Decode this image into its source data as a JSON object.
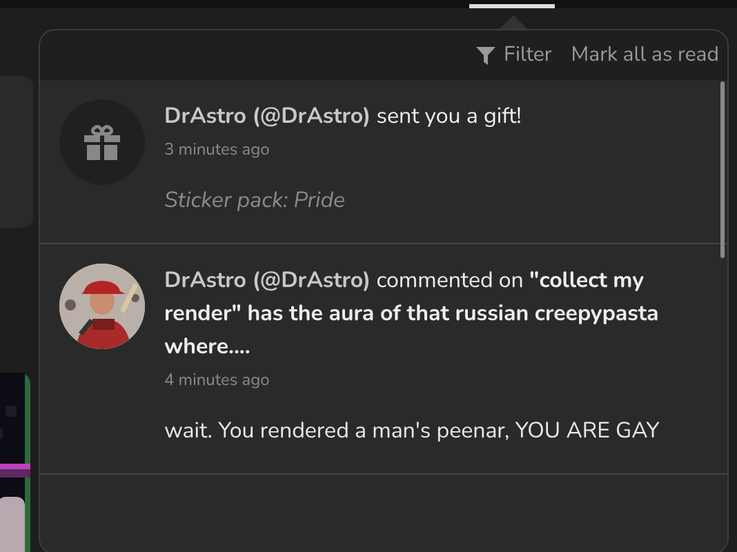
{
  "header": {
    "filter": "Filter",
    "mark_all": "Mark all as read"
  },
  "notifications": [
    {
      "kind": "gift",
      "text": "**DrAstro (@DrAstro)** sent you a gift!",
      "time": "3 minutes ago",
      "body": "Sticker pack: Pride"
    },
    {
      "kind": "comment",
      "text": "**DrAstro (@DrAstro)** commented on **\"collect my render\" has the aura of that russian creepypasta where....**",
      "time": "4 minutes ago",
      "body": "wait. You rendered a man's peenar, YOU ARE GAY"
    }
  ]
}
